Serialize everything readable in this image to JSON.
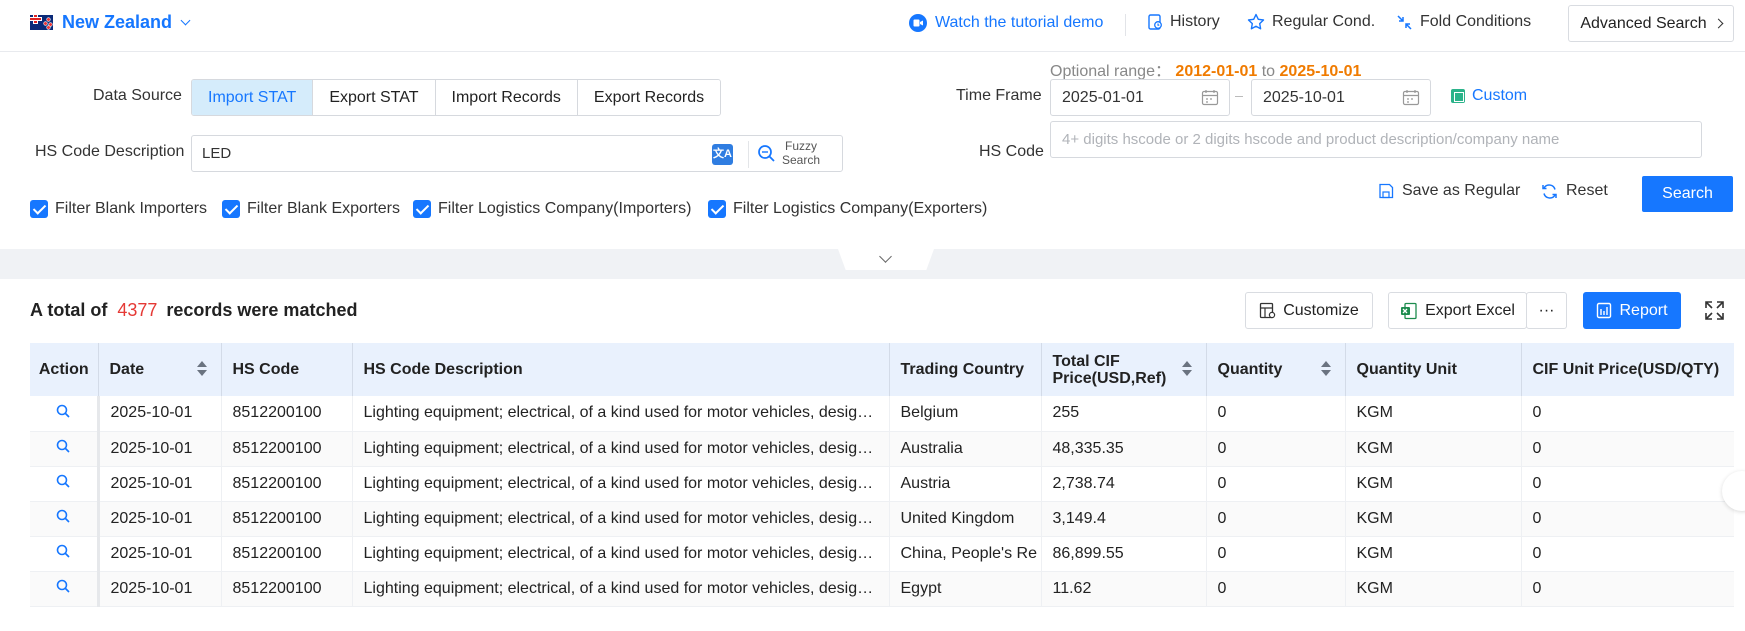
{
  "header": {
    "country": "New Zealand",
    "links": {
      "tutorial": "Watch the tutorial demo",
      "history": "History",
      "regular": "Regular Cond.",
      "fold": "Fold Conditions"
    },
    "advanced": "Advanced Search"
  },
  "filters": {
    "data_source_label": "Data Source",
    "data_sources": [
      "Import STAT",
      "Export STAT",
      "Import Records",
      "Export Records"
    ],
    "active_source": "Import STAT",
    "hs_desc_label": "HS Code Description",
    "hs_desc_value": "LED",
    "translate_icon": "translate-icon",
    "fuzzy_label_1": "Fuzzy",
    "fuzzy_label_2": "Search",
    "checkboxes": [
      "Filter Blank Importers",
      "Filter Blank Exporters",
      "Filter Logistics Company(Importers)",
      "Filter Logistics Company(Exporters)"
    ],
    "optional_range_label": "Optional range：",
    "optional_range_start": "2012-01-01",
    "optional_range_to": "to",
    "optional_range_end": "2025-10-01",
    "time_frame_label": "Time Frame",
    "date_start": "2025-01-01",
    "date_end": "2025-10-01",
    "custom": "Custom",
    "hs_code_label": "HS Code",
    "hs_code_placeholder": "4+ digits hscode or 2 digits hscode and product description/company name",
    "save_regular": "Save as Regular",
    "reset": "Reset",
    "search": "Search"
  },
  "results": {
    "prefix": "A total of",
    "count": "4377",
    "suffix": "records were matched",
    "customize": "Customize",
    "export_excel": "Export Excel",
    "more": "···",
    "report": "Report",
    "columns": [
      "Action",
      "Date",
      "HS Code",
      "HS Code Description",
      "Trading Country",
      "Total CIF Price(USD,Ref)",
      "Quantity",
      "Quantity Unit",
      "CIF Unit Price(USD/QTY)"
    ],
    "rows": [
      {
        "date": "2025-10-01",
        "hs": "8512200100",
        "desc": "Lighting equipment; electrical, of a kind used for motor vehicles, designed for use in motor vehicles",
        "country": "Belgium",
        "cif": "255",
        "qty": "0",
        "unit": "KGM",
        "unit_price": "0"
      },
      {
        "date": "2025-10-01",
        "hs": "8512200100",
        "desc": "Lighting equipment; electrical, of a kind used for motor vehicles, designed for use in motor vehicles",
        "country": "Australia",
        "cif": "48,335.35",
        "qty": "0",
        "unit": "KGM",
        "unit_price": "0"
      },
      {
        "date": "2025-10-01",
        "hs": "8512200100",
        "desc": "Lighting equipment; electrical, of a kind used for motor vehicles, designed for use in motor vehicles",
        "country": "Austria",
        "cif": "2,738.74",
        "qty": "0",
        "unit": "KGM",
        "unit_price": "0"
      },
      {
        "date": "2025-10-01",
        "hs": "8512200100",
        "desc": "Lighting equipment; electrical, of a kind used for motor vehicles, designed for use in motor vehicles",
        "country": "United Kingdom",
        "cif": "3,149.4",
        "qty": "0",
        "unit": "KGM",
        "unit_price": "0"
      },
      {
        "date": "2025-10-01",
        "hs": "8512200100",
        "desc": "Lighting equipment; electrical, of a kind used for motor vehicles, designed for use in motor vehicles",
        "country": "China, People's Re",
        "cif": "86,899.55",
        "qty": "0",
        "unit": "KGM",
        "unit_price": "0"
      },
      {
        "date": "2025-10-01",
        "hs": "8512200100",
        "desc": "Lighting equipment; electrical, of a kind used for motor vehicles, designed for use in motor vehicles",
        "country": "Egypt",
        "cif": "11.62",
        "qty": "0",
        "unit": "KGM",
        "unit_price": "0"
      }
    ]
  },
  "colors": {
    "accent": "#1677ff",
    "count_red": "#e53935",
    "date_orange": "#f07b00",
    "header_bg": "#e9f1fd"
  }
}
